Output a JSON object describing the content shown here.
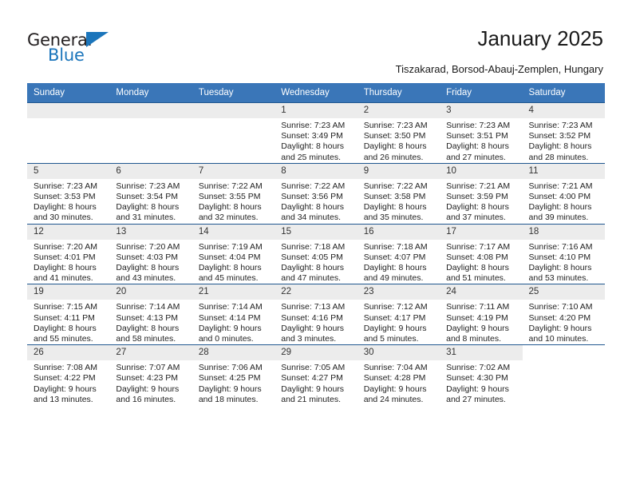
{
  "brand": {
    "name_part1": "General",
    "name_part2": "Blue",
    "accent_color": "#1b75bb"
  },
  "header": {
    "title": "January 2025",
    "subtitle": "Tiszakarad, Borsod-Abauj-Zemplen, Hungary"
  },
  "calendar": {
    "header_color": "#3a76b8",
    "weekday_headers": [
      "Sunday",
      "Monday",
      "Tuesday",
      "Wednesday",
      "Thursday",
      "Friday",
      "Saturday"
    ],
    "weeks": [
      [
        {
          "day": "",
          "empty": true,
          "lines": []
        },
        {
          "day": "",
          "empty": true,
          "lines": []
        },
        {
          "day": "",
          "empty": true,
          "lines": []
        },
        {
          "day": "1",
          "lines": [
            "Sunrise: 7:23 AM",
            "Sunset: 3:49 PM",
            "Daylight: 8 hours",
            "and 25 minutes."
          ]
        },
        {
          "day": "2",
          "lines": [
            "Sunrise: 7:23 AM",
            "Sunset: 3:50 PM",
            "Daylight: 8 hours",
            "and 26 minutes."
          ]
        },
        {
          "day": "3",
          "lines": [
            "Sunrise: 7:23 AM",
            "Sunset: 3:51 PM",
            "Daylight: 8 hours",
            "and 27 minutes."
          ]
        },
        {
          "day": "4",
          "lines": [
            "Sunrise: 7:23 AM",
            "Sunset: 3:52 PM",
            "Daylight: 8 hours",
            "and 28 minutes."
          ]
        }
      ],
      [
        {
          "day": "5",
          "lines": [
            "Sunrise: 7:23 AM",
            "Sunset: 3:53 PM",
            "Daylight: 8 hours",
            "and 30 minutes."
          ]
        },
        {
          "day": "6",
          "lines": [
            "Sunrise: 7:23 AM",
            "Sunset: 3:54 PM",
            "Daylight: 8 hours",
            "and 31 minutes."
          ]
        },
        {
          "day": "7",
          "lines": [
            "Sunrise: 7:22 AM",
            "Sunset: 3:55 PM",
            "Daylight: 8 hours",
            "and 32 minutes."
          ]
        },
        {
          "day": "8",
          "lines": [
            "Sunrise: 7:22 AM",
            "Sunset: 3:56 PM",
            "Daylight: 8 hours",
            "and 34 minutes."
          ]
        },
        {
          "day": "9",
          "lines": [
            "Sunrise: 7:22 AM",
            "Sunset: 3:58 PM",
            "Daylight: 8 hours",
            "and 35 minutes."
          ]
        },
        {
          "day": "10",
          "lines": [
            "Sunrise: 7:21 AM",
            "Sunset: 3:59 PM",
            "Daylight: 8 hours",
            "and 37 minutes."
          ]
        },
        {
          "day": "11",
          "lines": [
            "Sunrise: 7:21 AM",
            "Sunset: 4:00 PM",
            "Daylight: 8 hours",
            "and 39 minutes."
          ]
        }
      ],
      [
        {
          "day": "12",
          "lines": [
            "Sunrise: 7:20 AM",
            "Sunset: 4:01 PM",
            "Daylight: 8 hours",
            "and 41 minutes."
          ]
        },
        {
          "day": "13",
          "lines": [
            "Sunrise: 7:20 AM",
            "Sunset: 4:03 PM",
            "Daylight: 8 hours",
            "and 43 minutes."
          ]
        },
        {
          "day": "14",
          "lines": [
            "Sunrise: 7:19 AM",
            "Sunset: 4:04 PM",
            "Daylight: 8 hours",
            "and 45 minutes."
          ]
        },
        {
          "day": "15",
          "lines": [
            "Sunrise: 7:18 AM",
            "Sunset: 4:05 PM",
            "Daylight: 8 hours",
            "and 47 minutes."
          ]
        },
        {
          "day": "16",
          "lines": [
            "Sunrise: 7:18 AM",
            "Sunset: 4:07 PM",
            "Daylight: 8 hours",
            "and 49 minutes."
          ]
        },
        {
          "day": "17",
          "lines": [
            "Sunrise: 7:17 AM",
            "Sunset: 4:08 PM",
            "Daylight: 8 hours",
            "and 51 minutes."
          ]
        },
        {
          "day": "18",
          "lines": [
            "Sunrise: 7:16 AM",
            "Sunset: 4:10 PM",
            "Daylight: 8 hours",
            "and 53 minutes."
          ]
        }
      ],
      [
        {
          "day": "19",
          "lines": [
            "Sunrise: 7:15 AM",
            "Sunset: 4:11 PM",
            "Daylight: 8 hours",
            "and 55 minutes."
          ]
        },
        {
          "day": "20",
          "lines": [
            "Sunrise: 7:14 AM",
            "Sunset: 4:13 PM",
            "Daylight: 8 hours",
            "and 58 minutes."
          ]
        },
        {
          "day": "21",
          "lines": [
            "Sunrise: 7:14 AM",
            "Sunset: 4:14 PM",
            "Daylight: 9 hours",
            "and 0 minutes."
          ]
        },
        {
          "day": "22",
          "lines": [
            "Sunrise: 7:13 AM",
            "Sunset: 4:16 PM",
            "Daylight: 9 hours",
            "and 3 minutes."
          ]
        },
        {
          "day": "23",
          "lines": [
            "Sunrise: 7:12 AM",
            "Sunset: 4:17 PM",
            "Daylight: 9 hours",
            "and 5 minutes."
          ]
        },
        {
          "day": "24",
          "lines": [
            "Sunrise: 7:11 AM",
            "Sunset: 4:19 PM",
            "Daylight: 9 hours",
            "and 8 minutes."
          ]
        },
        {
          "day": "25",
          "lines": [
            "Sunrise: 7:10 AM",
            "Sunset: 4:20 PM",
            "Daylight: 9 hours",
            "and 10 minutes."
          ]
        }
      ],
      [
        {
          "day": "26",
          "lines": [
            "Sunrise: 7:08 AM",
            "Sunset: 4:22 PM",
            "Daylight: 9 hours",
            "and 13 minutes."
          ]
        },
        {
          "day": "27",
          "lines": [
            "Sunrise: 7:07 AM",
            "Sunset: 4:23 PM",
            "Daylight: 9 hours",
            "and 16 minutes."
          ]
        },
        {
          "day": "28",
          "lines": [
            "Sunrise: 7:06 AM",
            "Sunset: 4:25 PM",
            "Daylight: 9 hours",
            "and 18 minutes."
          ]
        },
        {
          "day": "29",
          "lines": [
            "Sunrise: 7:05 AM",
            "Sunset: 4:27 PM",
            "Daylight: 9 hours",
            "and 21 minutes."
          ]
        },
        {
          "day": "30",
          "lines": [
            "Sunrise: 7:04 AM",
            "Sunset: 4:28 PM",
            "Daylight: 9 hours",
            "and 24 minutes."
          ]
        },
        {
          "day": "31",
          "lines": [
            "Sunrise: 7:02 AM",
            "Sunset: 4:30 PM",
            "Daylight: 9 hours",
            "and 27 minutes."
          ]
        },
        {
          "day": "",
          "blank": true,
          "lines": []
        }
      ]
    ]
  }
}
